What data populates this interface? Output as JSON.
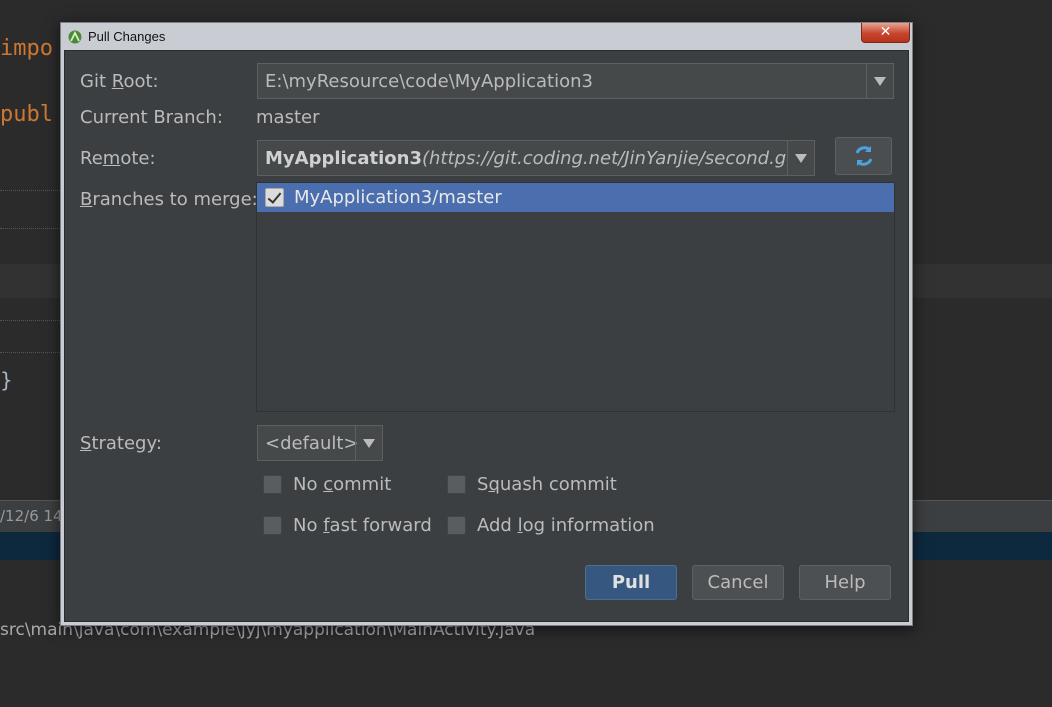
{
  "background": {
    "code_line1": "impo",
    "code_line2": "publ",
    "brace": "}",
    "timestamp": "/12/6 14",
    "path": "src\\main\\java\\com\\example\\jyj\\myapplication\\MainActivity.java"
  },
  "dialog": {
    "title": "Pull Changes",
    "close_glyph": "✕",
    "git_root": {
      "label_pre": "Git ",
      "label_mn": "R",
      "label_post": "oot:",
      "value": "E:\\myResource\\code\\MyApplication3"
    },
    "current_branch": {
      "label": "Current Branch:",
      "value": "master"
    },
    "remote": {
      "label_pre": "Re",
      "label_mn": "m",
      "label_post": "ote:",
      "name": "MyApplication3",
      "url": "(https://git.coding.net/JinYanjie/second.git)"
    },
    "branches": {
      "label_pre": "",
      "label_mn": "B",
      "label_post": "ranches to merge:",
      "items": [
        {
          "label": "MyApplication3/master",
          "checked": true
        }
      ]
    },
    "strategy": {
      "label_pre": "",
      "label_mn": "S",
      "label_post": "trategy:",
      "value": "<default>"
    },
    "options": {
      "no_commit": {
        "pre": "No ",
        "mn": "c",
        "post": "ommit",
        "checked": false
      },
      "squash_commit": {
        "pre": "S",
        "mn": "q",
        "post": "uash commit",
        "checked": false
      },
      "no_fast_forward": {
        "pre": "No ",
        "mn": "f",
        "post": "ast forward",
        "checked": false
      },
      "add_log": {
        "pre": "Add ",
        "mn": "l",
        "post": "og information",
        "checked": false
      }
    },
    "buttons": {
      "pull": "Pull",
      "cancel": "Cancel",
      "help": "Help"
    }
  },
  "colors": {
    "accent": "#4b6eaf",
    "default_button": "#365880",
    "dialog_bg": "#3c3f41"
  }
}
